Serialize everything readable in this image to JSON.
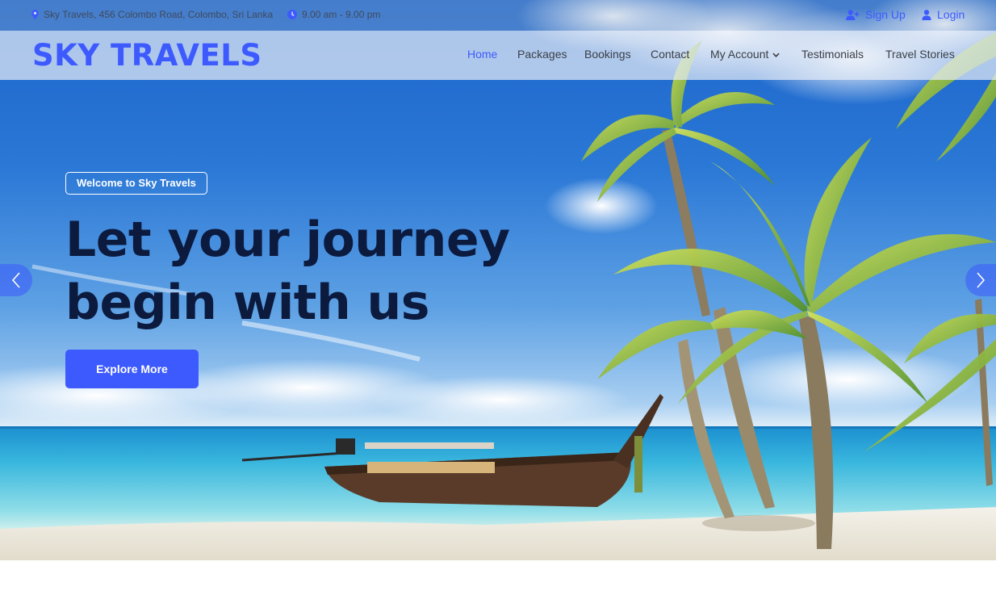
{
  "topbar": {
    "address": "Sky Travels, 456 Colombo Road, Colombo, Sri Lanka",
    "hours": "9.00 am - 9.00 pm",
    "signup_label": "Sign Up",
    "login_label": "Login",
    "icons": [
      "map-pin-icon",
      "clock-icon",
      "user-plus-icon",
      "user-icon"
    ]
  },
  "header": {
    "logo": "SKY TRAVELS",
    "nav": [
      {
        "label": "Home",
        "active": true
      },
      {
        "label": "Packages"
      },
      {
        "label": "Bookings"
      },
      {
        "label": "Contact"
      },
      {
        "label": "My Account",
        "dropdown": true
      },
      {
        "label": "Testimonials"
      },
      {
        "label": "Travel Stories"
      }
    ]
  },
  "hero": {
    "badge": "Welcome to Sky Travels",
    "headline_line1": "Let your journey",
    "headline_line2": "begin with us",
    "cta_label": "Explore More",
    "prev_icon": "chevron-left-icon",
    "next_icon": "chevron-right-icon"
  },
  "colors": {
    "accent": "#3d5afe",
    "headline": "#0c1a3e"
  }
}
